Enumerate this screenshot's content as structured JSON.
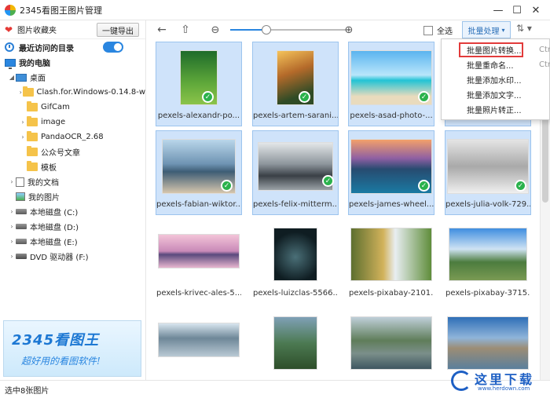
{
  "window": {
    "title": "2345看图王图片管理",
    "controls": [
      "—",
      "☐",
      "✕"
    ]
  },
  "sidebar": {
    "favorites_label": "图片收藏夹",
    "export_button": "一键导出",
    "recent_label": "最近访问的目录",
    "recent_enabled": true,
    "my_computer": "我的电脑",
    "desktop": "桌面",
    "folders": [
      "Clash.for.Windows-0.14.8-w",
      "GifCam",
      "image",
      "PandaOCR_2.68",
      "公众号文章",
      "模板"
    ],
    "my_documents": "我的文档",
    "my_pictures": "我的图片",
    "drives": [
      "本地磁盘 (C:)",
      "本地磁盘 (D:)",
      "本地磁盘 (E:)",
      "DVD 驱动器 (F:)"
    ],
    "banner_logo": "2345看图王",
    "banner_slogan": "超好用的看图软件!"
  },
  "toolbar": {
    "select_all_label": "全选",
    "batch_label": "批量处理",
    "batch_arrow": "▾",
    "sort_icon": "⇅ ▾"
  },
  "batch_menu": {
    "items": [
      {
        "label": "批量图片转换...",
        "shortcut": "Ctr"
      },
      {
        "label": "批量重命名...",
        "shortcut": "Ctr"
      },
      {
        "label": "批量添加水印...",
        "shortcut": ""
      },
      {
        "label": "批量添加文字...",
        "shortcut": ""
      },
      {
        "label": "批量照片转正...",
        "shortcut": ""
      }
    ]
  },
  "images": [
    {
      "name": "pexels-alexandr-po...",
      "selected": true
    },
    {
      "name": "pexels-artem-sarani...",
      "selected": true
    },
    {
      "name": "pexels-asad-photo-...",
      "selected": true
    },
    {
      "name": "pexels-fabian-wiktor...",
      "selected": true
    },
    {
      "name": "pexels-felix-mitterm...",
      "selected": true
    },
    {
      "name": "pexels-james-wheel...",
      "selected": true
    },
    {
      "name": "pexels-julia-volk-729...",
      "selected": true
    },
    {
      "name": "pexels-krivec-ales-5...",
      "selected": false
    },
    {
      "name": "pexels-luizclas-5566...",
      "selected": false
    },
    {
      "name": "pexels-pixabay-2101...",
      "selected": false
    },
    {
      "name": "pexels-pixabay-3715...",
      "selected": false
    },
    {
      "name": "",
      "selected": false
    },
    {
      "name": "",
      "selected": false
    },
    {
      "name": "",
      "selected": false
    },
    {
      "name": "",
      "selected": false
    }
  ],
  "status": {
    "text": "选中8张图片"
  },
  "watermark": {
    "main": "这里下载",
    "sub": "www.herdown.com"
  }
}
